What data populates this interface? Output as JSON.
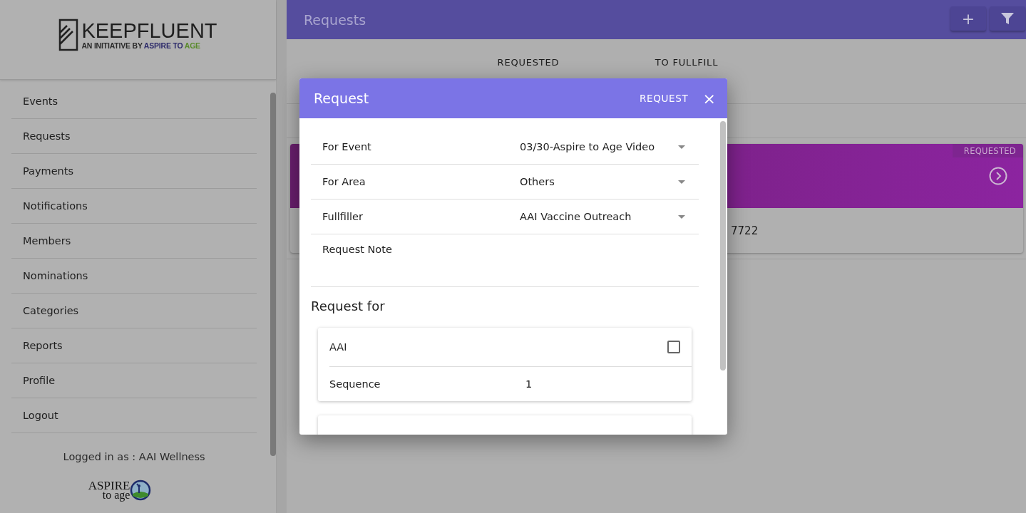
{
  "sidebar": {
    "logo": {
      "title": "KEEPFLUENT",
      "subtitle_parts": [
        {
          "text": "AN INITIATIVE BY ",
          "kind": "plain"
        },
        {
          "text": "ASPIRE TO ",
          "kind": "blue"
        },
        {
          "text": "AGE",
          "kind": "green"
        }
      ]
    },
    "items": [
      {
        "label": "Events"
      },
      {
        "label": "Requests"
      },
      {
        "label": "Payments"
      },
      {
        "label": "Notifications"
      },
      {
        "label": "Members"
      },
      {
        "label": "Nominations"
      },
      {
        "label": "Categories"
      },
      {
        "label": "Reports"
      },
      {
        "label": "Profile"
      },
      {
        "label": "Logout"
      }
    ],
    "logged_in": "Logged in as : AAI Wellness",
    "footer_logo": {
      "line1": "ASPIRE",
      "line2": "to age"
    }
  },
  "header": {
    "title": "Requests",
    "buttons": [
      {
        "kind": "add",
        "label": "+"
      },
      {
        "kind": "filter"
      }
    ]
  },
  "tabs": [
    {
      "label": "REQUESTED"
    },
    {
      "label": "TO FULLFILL"
    }
  ],
  "card": {
    "badge": "REQUESTED",
    "text": "7722"
  },
  "dialog": {
    "title": "Request",
    "action": "REQUEST",
    "close": "×",
    "fields": [
      {
        "label": "For Event",
        "value": "03/30-Aspire to Age Video",
        "kind": "select"
      },
      {
        "label": "For Area",
        "value": "Others",
        "kind": "select"
      },
      {
        "label": "Fullfiller",
        "value": "AAI Vaccine Outreach",
        "kind": "select"
      },
      {
        "label": "Request Note",
        "kind": "note"
      }
    ],
    "section": "Request for",
    "items": [
      {
        "name": "AAI",
        "checked": false,
        "sequence_label": "Sequence",
        "sequence": "1"
      },
      {
        "kind": "cut"
      }
    ]
  }
}
